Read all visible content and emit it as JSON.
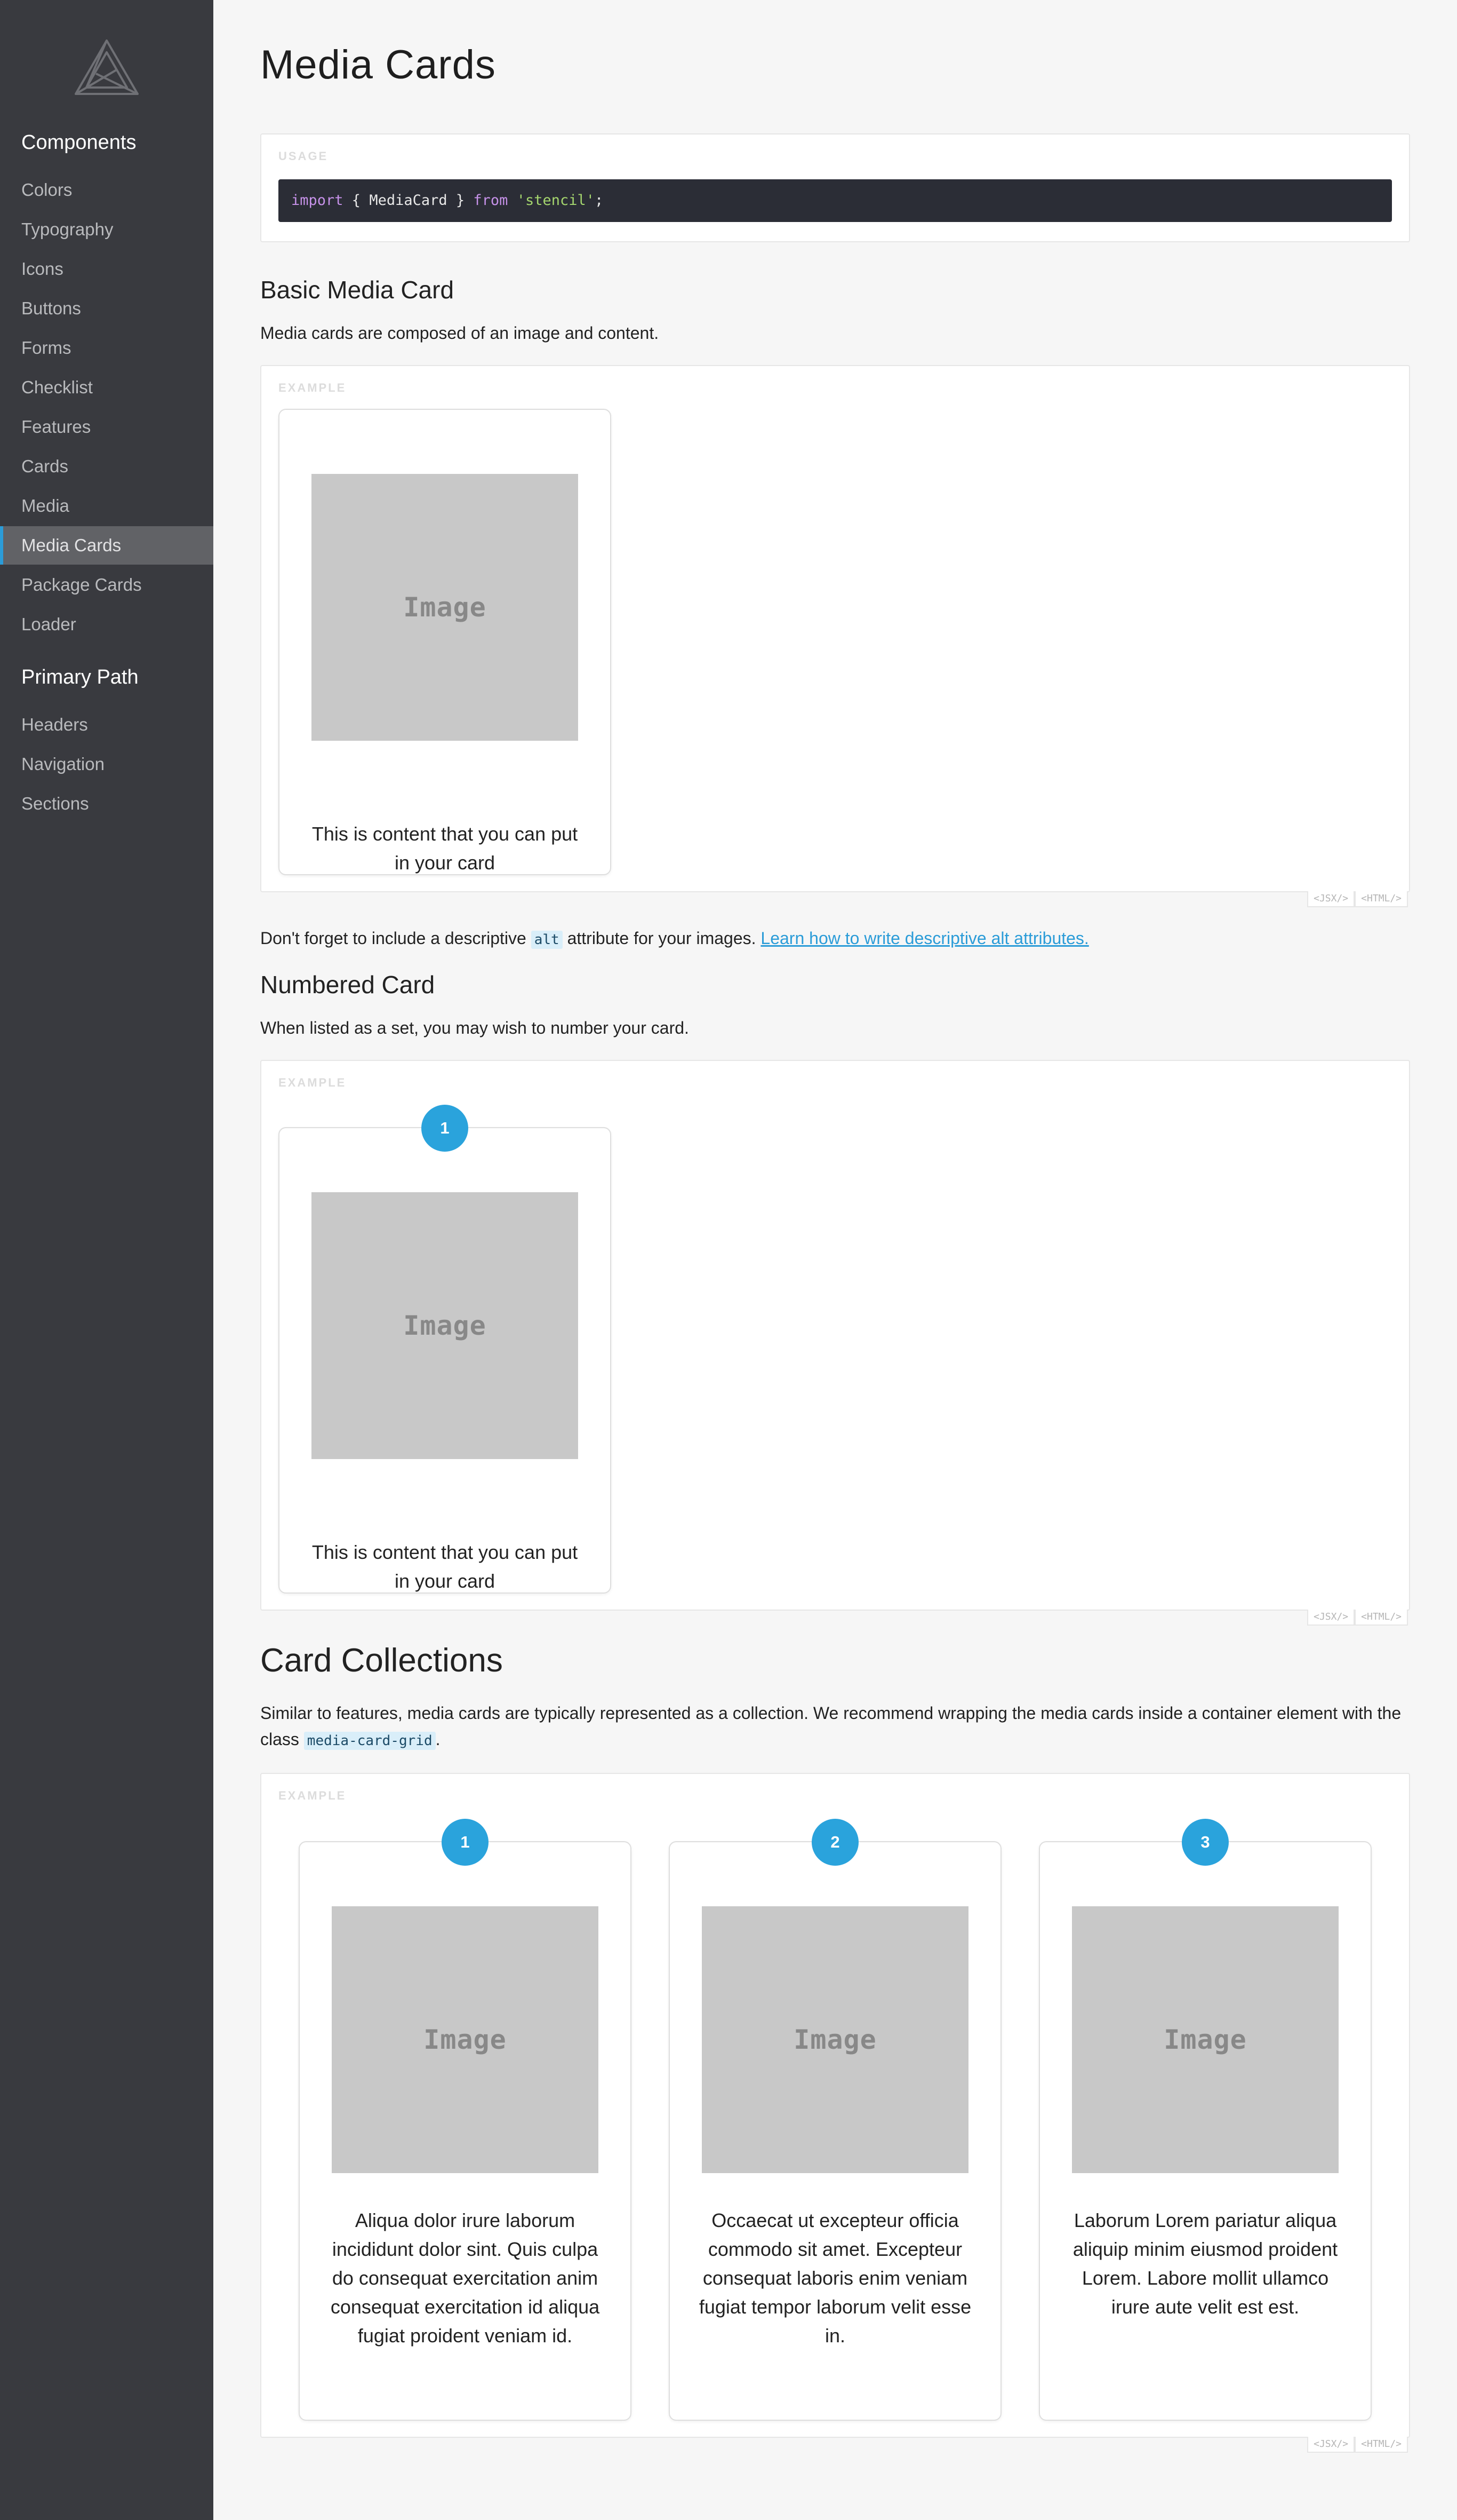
{
  "sidebar": {
    "logo_name": "logo-icon",
    "sections": [
      {
        "title": "Components",
        "items": [
          "Colors",
          "Typography",
          "Icons",
          "Buttons",
          "Forms",
          "Checklist",
          "Features",
          "Cards",
          "Media",
          "Media Cards",
          "Package Cards",
          "Loader"
        ]
      },
      {
        "title": "Primary Path",
        "items": [
          "Headers",
          "Navigation",
          "Sections"
        ]
      }
    ],
    "active_item": "Media Cards"
  },
  "page": {
    "title": "Media Cards"
  },
  "usage": {
    "label": "USAGE",
    "code": {
      "import_kw": "import",
      "braces": " { MediaCard } ",
      "from_kw": "from",
      "module": "'stencil'",
      "semicolon": ";"
    }
  },
  "basic": {
    "title": "Basic Media Card",
    "description": "Media cards are composed of an image and content.",
    "example_label": "EXAMPLE",
    "card": {
      "image_label": "Image",
      "content": "This is content that you can put in your card"
    },
    "tabs": [
      "<JSX/>",
      "<HTML/>"
    ],
    "note_before": "Don't forget to include a descriptive ",
    "note_code": "alt",
    "note_after": " attribute for your images. ",
    "note_link": "Learn how to write descriptive alt attributes."
  },
  "numbered": {
    "title": "Numbered Card",
    "description": "When listed as a set, you may wish to number your card.",
    "example_label": "EXAMPLE",
    "card": {
      "number": "1",
      "image_label": "Image",
      "content": "This is content that you can put in your card"
    },
    "tabs": [
      "<JSX/>",
      "<HTML/>"
    ]
  },
  "collections": {
    "title": "Card Collections",
    "description_before": "Similar to features, media cards are typically represented as a collection. We recommend wrapping the media cards inside a container element with the class ",
    "description_code": "media-card-grid",
    "description_after": ".",
    "example_label": "EXAMPLE",
    "cards": [
      {
        "number": "1",
        "image_label": "Image",
        "content": "Aliqua dolor irure laborum incididunt dolor sint. Quis culpa do consequat exercitation anim consequat exercitation id aliqua fugiat proident veniam id."
      },
      {
        "number": "2",
        "image_label": "Image",
        "content": "Occaecat ut excepteur officia commodo sit amet. Excepteur consequat laboris enim veniam fugiat tempor laborum velit esse in."
      },
      {
        "number": "3",
        "image_label": "Image",
        "content": "Laborum Lorem pariatur aliqua aliquip minim eiusmod proident Lorem. Labore mollit ullamco irure aute velit est est."
      }
    ],
    "tabs": [
      "<JSX/>",
      "<HTML/>"
    ]
  },
  "colors": {
    "sidebar_bg": "#393a3f",
    "accent": "#2b9cd8",
    "badge": "#2aa3dc",
    "image_placeholder": "#c8c8c8"
  }
}
